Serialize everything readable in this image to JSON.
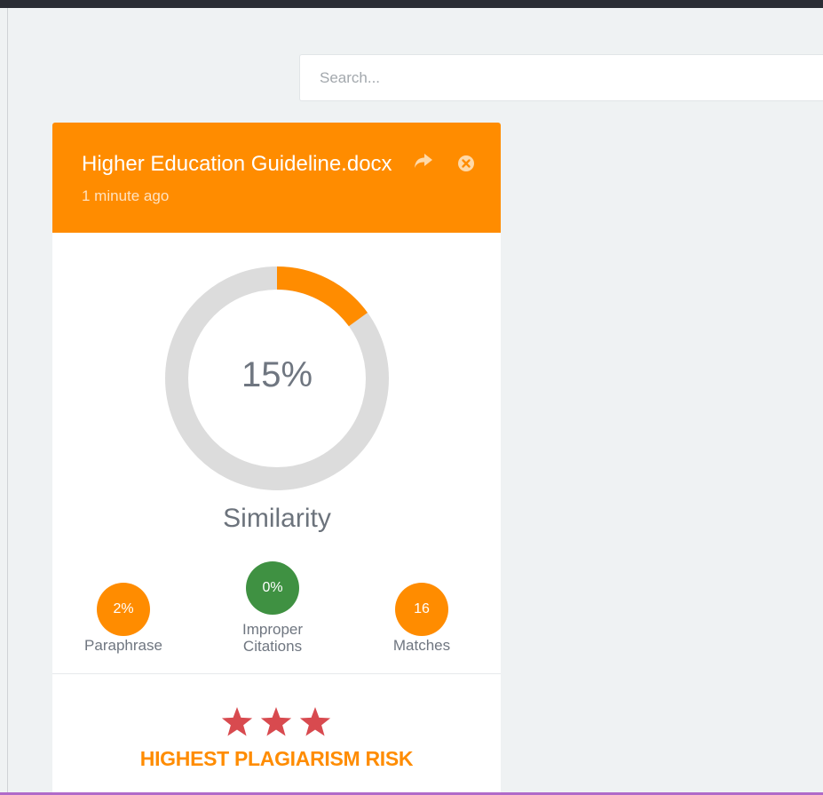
{
  "search": {
    "placeholder": "Search..."
  },
  "card": {
    "title": "Higher Education Guideline.docx",
    "time": "1 minute ago",
    "similarity": {
      "value": 15,
      "display": "15%",
      "label": "Similarity"
    },
    "stats": [
      {
        "value": "2%",
        "label": "Paraphrase",
        "color": "#ff8c00"
      },
      {
        "value": "0%",
        "label": "Improper Citations",
        "color": "#3f9142"
      },
      {
        "value": "16",
        "label": "Matches",
        "color": "#ff8c00"
      }
    ],
    "risk": {
      "stars": 3,
      "label": "HIGHEST PLAGIARISM RISK"
    }
  },
  "colors": {
    "accent": "#ff8c00",
    "success": "#3f9142",
    "star": "#d84a4f",
    "track": "#dcdcdc"
  },
  "icons": [
    "share-icon",
    "close-circle-icon",
    "star-icon"
  ]
}
